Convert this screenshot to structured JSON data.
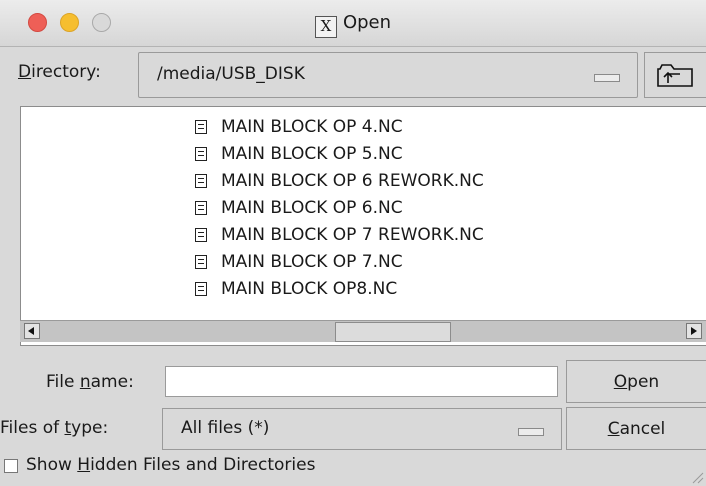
{
  "window": {
    "title": "Open",
    "title_icon": "x11-icon"
  },
  "directory": {
    "label_mnemonic": "D",
    "label_rest": "irectory:",
    "value": "/media/USB_DISK"
  },
  "files": [
    "MAIN BLOCK OP 4.NC",
    "MAIN BLOCK OP 5.NC",
    "MAIN BLOCK OP 6 REWORK.NC",
    "MAIN BLOCK OP 6.NC",
    "MAIN BLOCK OP 7 REWORK.NC",
    "MAIN BLOCK OP 7.NC",
    "MAIN BLOCK OP8.NC"
  ],
  "file_name": {
    "label_pre": "File ",
    "label_mnemonic": "n",
    "label_post": "ame:",
    "value": ""
  },
  "file_type": {
    "label_pre": "Files of ",
    "label_mnemonic": "t",
    "label_post": "ype:",
    "value": "All files (*)"
  },
  "buttons": {
    "open_mnemonic": "O",
    "open_rest": "pen",
    "cancel_mnemonic": "C",
    "cancel_rest": "ancel"
  },
  "hidden_toggle": {
    "label_pre": "Show ",
    "label_mnemonic": "H",
    "label_post": "idden Files and Directories",
    "checked": false
  },
  "colors": {
    "close": "#ee5f57",
    "minimize": "#f6be2f",
    "window_bg": "#d9d9d9"
  }
}
